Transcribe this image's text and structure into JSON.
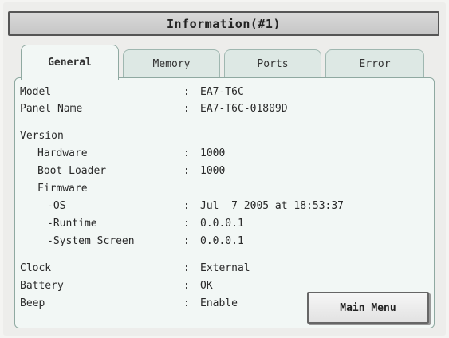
{
  "window": {
    "title": "Information(#1)"
  },
  "tabs": [
    {
      "label": "General",
      "active": true
    },
    {
      "label": "Memory",
      "active": false
    },
    {
      "label": "Ports",
      "active": false
    },
    {
      "label": "Error",
      "active": false
    }
  ],
  "fields": {
    "model": {
      "label": "Model",
      "value": "EA7-T6C"
    },
    "panel_name": {
      "label": "Panel Name",
      "value": "EA7-T6C-01809D"
    },
    "version": {
      "label": "Version"
    },
    "hardware": {
      "label": "Hardware",
      "value": "1000"
    },
    "boot_loader": {
      "label": "Boot Loader",
      "value": "1000"
    },
    "firmware": {
      "label": "Firmware"
    },
    "os": {
      "label": "-OS",
      "value": "Jul  7 2005 at 18:53:37"
    },
    "runtime": {
      "label": "-Runtime",
      "value": "0.0.0.1"
    },
    "system_screen": {
      "label": "-System Screen",
      "value": "0.0.0.1"
    },
    "clock": {
      "label": "Clock",
      "value": "External"
    },
    "battery": {
      "label": "Battery",
      "value": "OK"
    },
    "beep": {
      "label": "Beep",
      "value": "Enable"
    }
  },
  "separator": ":",
  "buttons": {
    "main_menu": "Main Menu"
  }
}
